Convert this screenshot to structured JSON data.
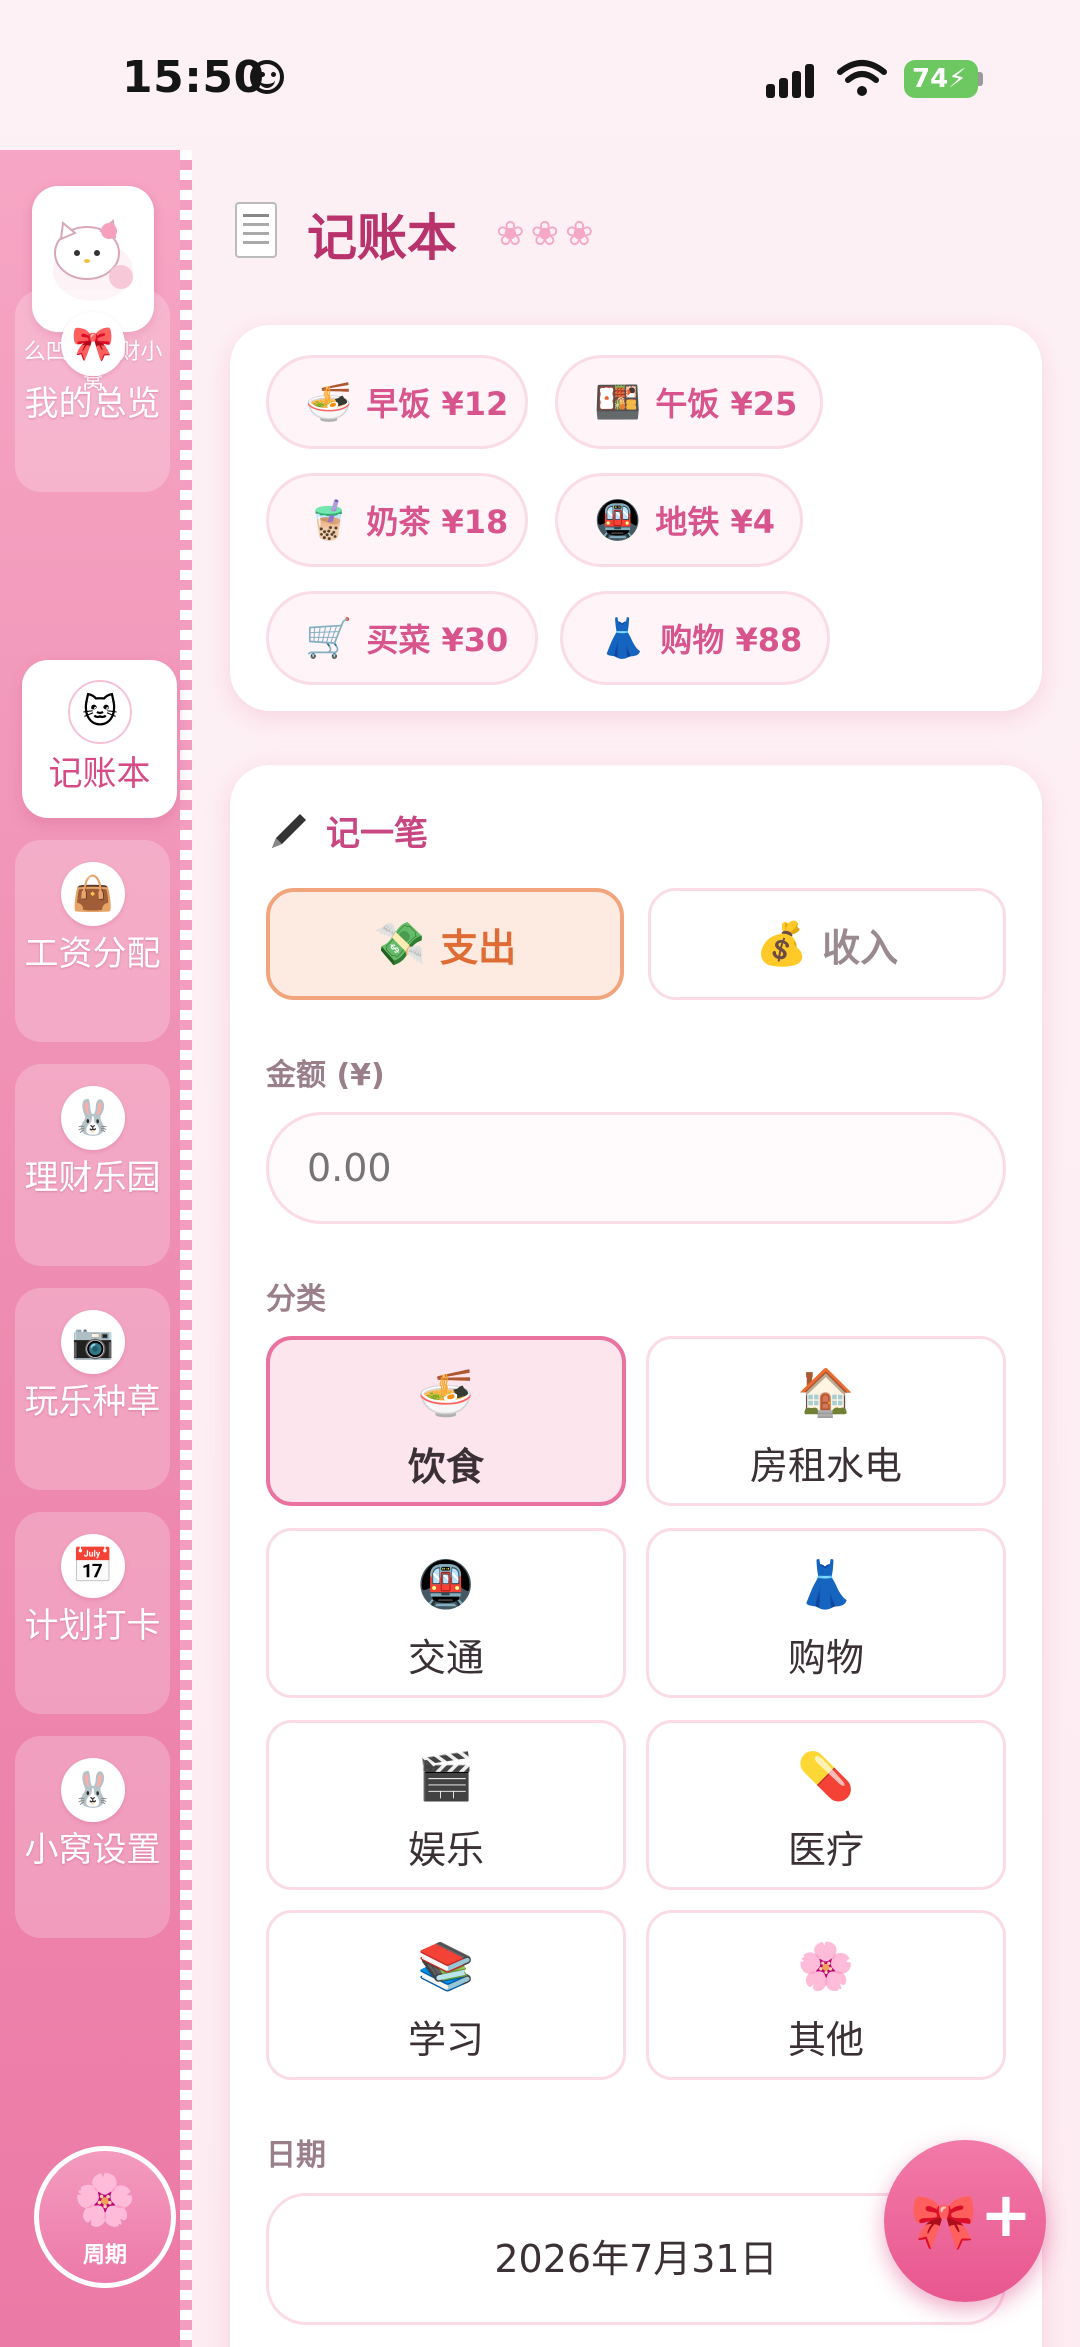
{
  "status_bar": {
    "time": "15:50",
    "battery": "74"
  },
  "sidebar": {
    "app_name": "么凹猫 理财小窝",
    "items": [
      {
        "label": "我的总览",
        "icon": "🎀"
      },
      {
        "label": "记账本",
        "icon": "🐱"
      },
      {
        "label": "工资分配",
        "icon": "👜"
      },
      {
        "label": "理财乐园",
        "icon": "🐰"
      },
      {
        "label": "玩乐种草",
        "icon": "📷"
      },
      {
        "label": "计划打卡",
        "icon": "📅"
      },
      {
        "label": "小窝设置",
        "icon": "🐰"
      }
    ],
    "period_button": {
      "label": "周期",
      "icon": "🌸"
    }
  },
  "header": {
    "title": "记账本",
    "deco": "❀❀❀"
  },
  "quick_items": [
    {
      "icon": "🍜",
      "text": "早饭 ¥12"
    },
    {
      "icon": "🍱",
      "text": "午饭 ¥25"
    },
    {
      "icon": "🧋",
      "text": "奶茶 ¥18"
    },
    {
      "icon": "🚇",
      "text": "地铁 ¥4"
    },
    {
      "icon": "🛒",
      "text": "买菜 ¥30"
    },
    {
      "icon": "👗",
      "text": "购物 ¥88"
    }
  ],
  "record": {
    "title": "记一笔",
    "expense": {
      "icon": "💸",
      "label": "支出"
    },
    "income": {
      "icon": "💰",
      "label": "收入"
    },
    "amount_label": "金额 (¥)",
    "amount_placeholder": "0.00",
    "category_label": "分类",
    "categories": [
      {
        "icon": "🍜",
        "label": "饮食"
      },
      {
        "icon": "🏠",
        "label": "房租水电"
      },
      {
        "icon": "🚇",
        "label": "交通"
      },
      {
        "icon": "👗",
        "label": "购物"
      },
      {
        "icon": "🎬",
        "label": "娱乐"
      },
      {
        "icon": "💊",
        "label": "医疗"
      },
      {
        "icon": "📚",
        "label": "学习"
      },
      {
        "icon": "🌸",
        "label": "其他"
      }
    ],
    "date_label": "日期",
    "date_value": "2026年7月31日"
  },
  "fab": {
    "icon": "🎀",
    "plus": "+"
  },
  "colors": {
    "accent": "#e8578f",
    "title": "#b8336b",
    "expense": "#df6c34"
  }
}
